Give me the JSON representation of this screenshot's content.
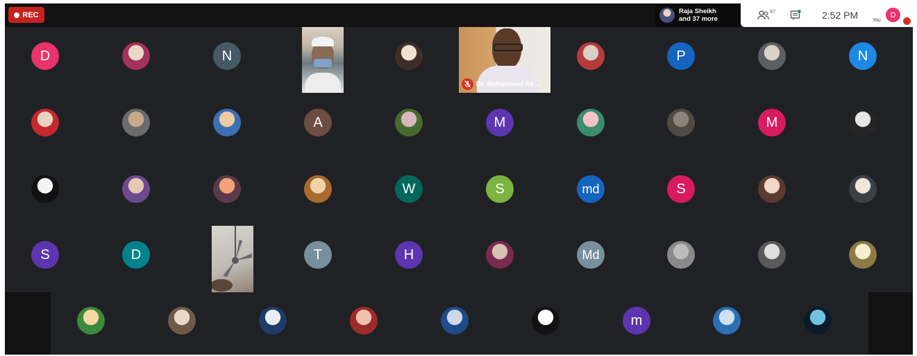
{
  "topbar": {
    "rec_label": "REC",
    "speaker_line1": "Raja Sheikh",
    "speaker_line2": "and 37 more",
    "participants_count": "87",
    "clock": "2:52 PM",
    "you_label": "You",
    "you_initial": "D"
  },
  "featured_video_name": "Dr. Mohammad Ali ...",
  "colors": {
    "background": "#202124",
    "rec": "#c5221f"
  },
  "rows": [
    [
      {
        "kind": "initial",
        "text": "D",
        "color": "#e8336d"
      },
      {
        "kind": "photo",
        "g": "#e9d7c6,#a2325a"
      },
      {
        "kind": "initial",
        "text": "N",
        "color": "#455a64"
      },
      {
        "kind": "video"
      },
      {
        "kind": "photo",
        "g": "#f1e1d2,#3e2e28"
      },
      {
        "kind": "video-featured"
      },
      {
        "kind": "photo",
        "g": "#d8cfc6,#b63b3b"
      },
      {
        "kind": "initial",
        "text": "P",
        "color": "#1565c0"
      },
      {
        "kind": "photo",
        "g": "#d9d2c8,#5c5e63"
      },
      {
        "kind": "initial",
        "text": "N",
        "color": "#1e88e5"
      }
    ],
    [
      {
        "kind": "photo",
        "g": "#e9d4c1,#c5292e"
      },
      {
        "kind": "photo",
        "g": "#c9a98d,#6b6b6b"
      },
      {
        "kind": "photo",
        "g": "#f0c9a5,#3c6fb3"
      },
      {
        "kind": "initial",
        "text": "A",
        "color": "#6d4c41"
      },
      {
        "kind": "photo",
        "g": "#d9b7c1,#476b2e"
      },
      {
        "kind": "initial",
        "text": "M",
        "color": "#5e35b1"
      },
      {
        "kind": "photo",
        "g": "#f6c0c8,#3a8d6e"
      },
      {
        "kind": "photo",
        "g": "#8c8577,#4f4a43"
      },
      {
        "kind": "initial",
        "text": "M",
        "color": "#d81b60"
      },
      {
        "kind": "photo",
        "g": "#e6e6e6,#252525"
      }
    ],
    [
      {
        "kind": "photo",
        "g": "#f4f4f4,#111111"
      },
      {
        "kind": "photo",
        "g": "#e4c9b3,#6a4a8c"
      },
      {
        "kind": "photo",
        "g": "#f2a37a,#5b3b4a"
      },
      {
        "kind": "photo",
        "g": "#f0d3a8,#a86a2f"
      },
      {
        "kind": "initial",
        "text": "W",
        "color": "#00695c"
      },
      {
        "kind": "initial",
        "text": "S",
        "color": "#7cb342"
      },
      {
        "kind": "initial",
        "text": "md",
        "color": "#1565c0"
      },
      {
        "kind": "initial",
        "text": "S",
        "color": "#d81b60"
      },
      {
        "kind": "photo",
        "g": "#f0d7c8,#5a3a2f"
      },
      {
        "kind": "photo",
        "g": "#efe6dc,#3b4048"
      }
    ],
    [
      {
        "kind": "initial",
        "text": "S",
        "color": "#5e35b1"
      },
      {
        "kind": "initial",
        "text": "D",
        "color": "#00838f"
      },
      {
        "kind": "video-fan"
      },
      {
        "kind": "initial",
        "text": "T",
        "color": "#78909c"
      },
      {
        "kind": "initial",
        "text": "H",
        "color": "#5e35b1"
      },
      {
        "kind": "photo",
        "g": "#d7c2b3,#7a2a4f"
      },
      {
        "kind": "initial",
        "text": "Md",
        "color": "#78909c"
      },
      {
        "kind": "photo",
        "g": "#bdbdbd,#8a8a8a"
      },
      {
        "kind": "photo",
        "g": "#e0e0e0,#5a5a5a"
      },
      {
        "kind": "photo",
        "g": "#f6efcf,#8c7b45"
      }
    ]
  ],
  "bottom_row": [
    {
      "kind": "photo",
      "g": "#f5d9a5,#3c8a3c"
    },
    {
      "kind": "photo",
      "g": "#ead9c6,#6f5a4a"
    },
    {
      "kind": "photo",
      "g": "#e8eef3,#1f3b67"
    },
    {
      "kind": "photo",
      "g": "#f0c2a9,#9d2b2b"
    },
    {
      "kind": "photo",
      "g": "#cfd8e3,#1f4b8a"
    },
    {
      "kind": "photo",
      "g": "#ffffff,#111111"
    },
    {
      "kind": "initial",
      "text": "m",
      "color": "#5e35b1"
    },
    {
      "kind": "photo",
      "g": "#cfe0f1,#2d6fb3"
    },
    {
      "kind": "photo",
      "g": "#6fc3e0,#0c1b2b"
    }
  ]
}
